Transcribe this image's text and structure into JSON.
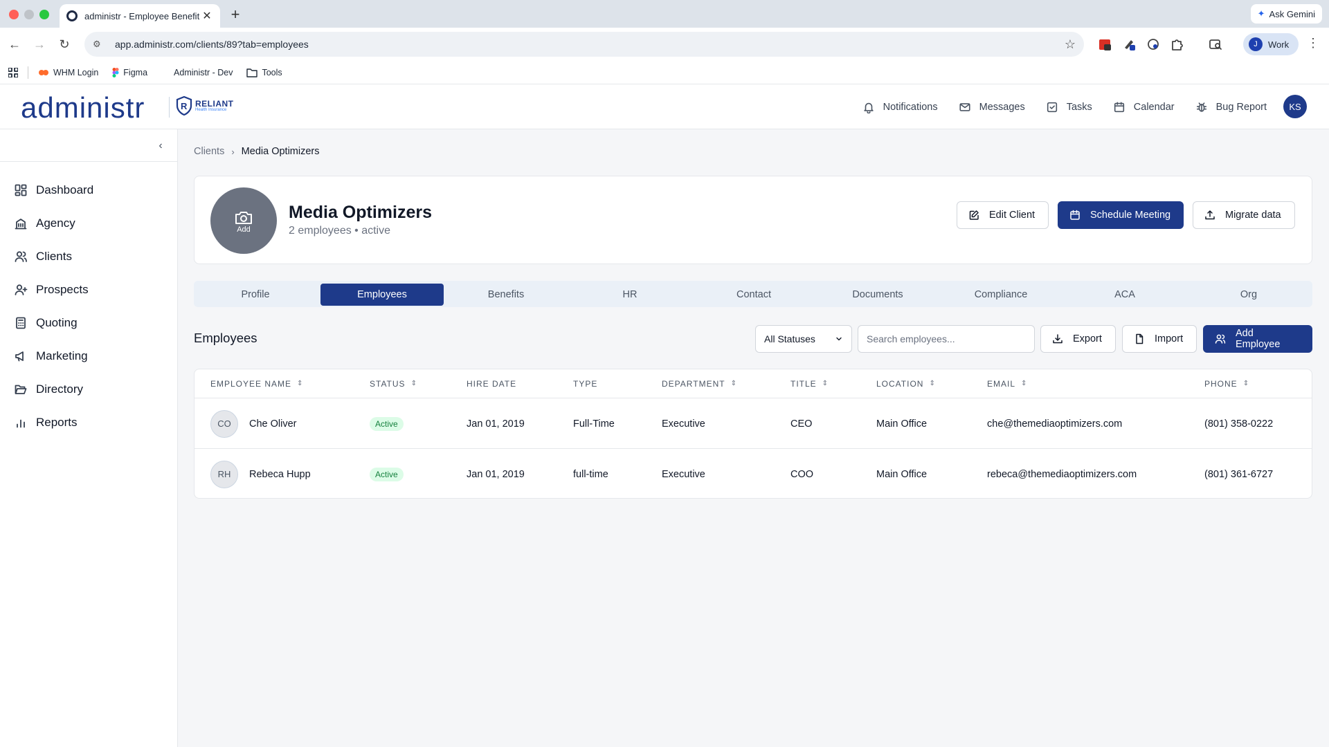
{
  "browser": {
    "tab_title": "administr - Employee Benefit",
    "url": "app.administr.com/clients/89?tab=employees",
    "ask_gemini": "Ask Gemini",
    "profile_initial": "J",
    "profile_label": "Work",
    "bookmarks": [
      "WHM Login",
      "Figma",
      "Administr - Dev",
      "Tools"
    ]
  },
  "header": {
    "logo": "administr",
    "partner_name": "RELIANT",
    "partner_sub": "Health Insurance",
    "nav": [
      "Notifications",
      "Messages",
      "Tasks",
      "Calendar",
      "Bug Report"
    ],
    "user_initials": "KS"
  },
  "sidebar": {
    "items": [
      "Dashboard",
      "Agency",
      "Clients",
      "Prospects",
      "Quoting",
      "Marketing",
      "Directory",
      "Reports"
    ]
  },
  "breadcrumb": {
    "parent": "Clients",
    "current": "Media Optimizers"
  },
  "client": {
    "name": "Media Optimizers",
    "meta": "2 employees • active",
    "avatar_label": "Add",
    "actions": {
      "edit": "Edit Client",
      "schedule": "Schedule Meeting",
      "migrate": "Migrate data"
    }
  },
  "tabs": [
    "Profile",
    "Employees",
    "Benefits",
    "HR",
    "Contact",
    "Documents",
    "Compliance",
    "ACA",
    "Org"
  ],
  "active_tab": "Employees",
  "employees": {
    "title": "Employees",
    "status_filter": "All Statuses",
    "search_placeholder": "Search employees...",
    "export": "Export",
    "import": "Import",
    "add": "Add Employee",
    "columns": [
      "EMPLOYEE NAME",
      "STATUS",
      "HIRE DATE",
      "TYPE",
      "DEPARTMENT",
      "TITLE",
      "LOCATION",
      "EMAIL",
      "PHONE"
    ],
    "rows": [
      {
        "initials": "CO",
        "name": "Che Oliver",
        "status": "Active",
        "hire_date": "Jan 01, 2019",
        "type": "Full-Time",
        "department": "Executive",
        "title": "CEO",
        "location": "Main Office",
        "email": "che@themediaoptimizers.com",
        "phone": "(801) 358-0222"
      },
      {
        "initials": "RH",
        "name": "Rebeca Hupp",
        "status": "Active",
        "hire_date": "Jan 01, 2019",
        "type": "full-time",
        "department": "Executive",
        "title": "COO",
        "location": "Main Office",
        "email": "rebeca@themediaoptimizers.com",
        "phone": "(801) 361-6727"
      }
    ]
  },
  "colors": {
    "brand": "#1e3a8a",
    "active_badge_bg": "#dcfce7",
    "active_badge_text": "#15803d"
  }
}
